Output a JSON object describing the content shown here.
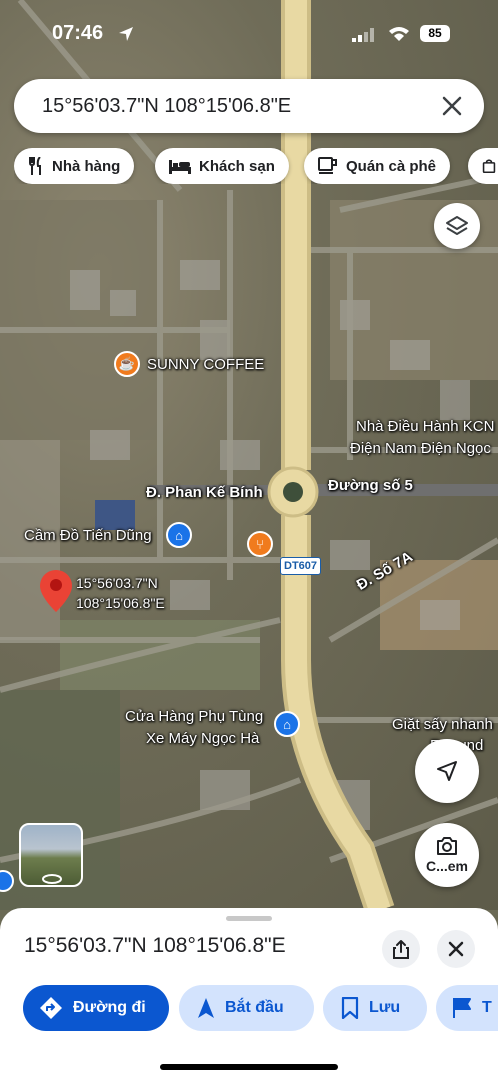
{
  "status": {
    "time": "07:46",
    "battery": "85"
  },
  "search": {
    "query": "15°56'03.7\"N 108°15'06.8\"E"
  },
  "chips": [
    {
      "label": "Nhà hàng",
      "icon": "fork-knife-icon"
    },
    {
      "label": "Khách sạn",
      "icon": "bed-icon"
    },
    {
      "label": "Quán cà phê",
      "icon": "coffee-cup-icon"
    }
  ],
  "map": {
    "labels": {
      "sunny_coffee": "SUNNY COFFEE",
      "nha_dieu_hanh_1": "Nhà Điều Hành KCN",
      "nha_dieu_hanh_2": "Điện Nam Điện Ngọc",
      "phan_ke_binh": "Đ. Phan Kế Bính",
      "duong_so_5": "Đường số 5",
      "cam_do": "Cầm Đồ Tiến Dũng",
      "dt607": "DT607",
      "so7a": "Đ. Số 7A",
      "pin_line1": "15°56'03.7\"N",
      "pin_line2": "108°15'06.8\"E",
      "cua_hang_1": "Cửa Hàng Phụ Tùng",
      "cua_hang_2": "Xe Máy Ngọc Hà",
      "giat_say": "Giặt sấy nhanh",
      "giat_say_2": "F...ound",
      "camera_label": "C...em"
    }
  },
  "sheet": {
    "title": "15°56'03.7\"N 108°15'06.8\"E",
    "actions": [
      {
        "label": "Đường đi",
        "primary": true
      },
      {
        "label": "Bắt đầu"
      },
      {
        "label": "Lưu"
      },
      {
        "label": "T"
      }
    ]
  },
  "colors": {
    "accent": "#0b57d0",
    "primary_button": "#0b57d0",
    "secondary_button": "#d3e3fd",
    "pin": "#ea4335",
    "road": "#e8d9a3"
  }
}
